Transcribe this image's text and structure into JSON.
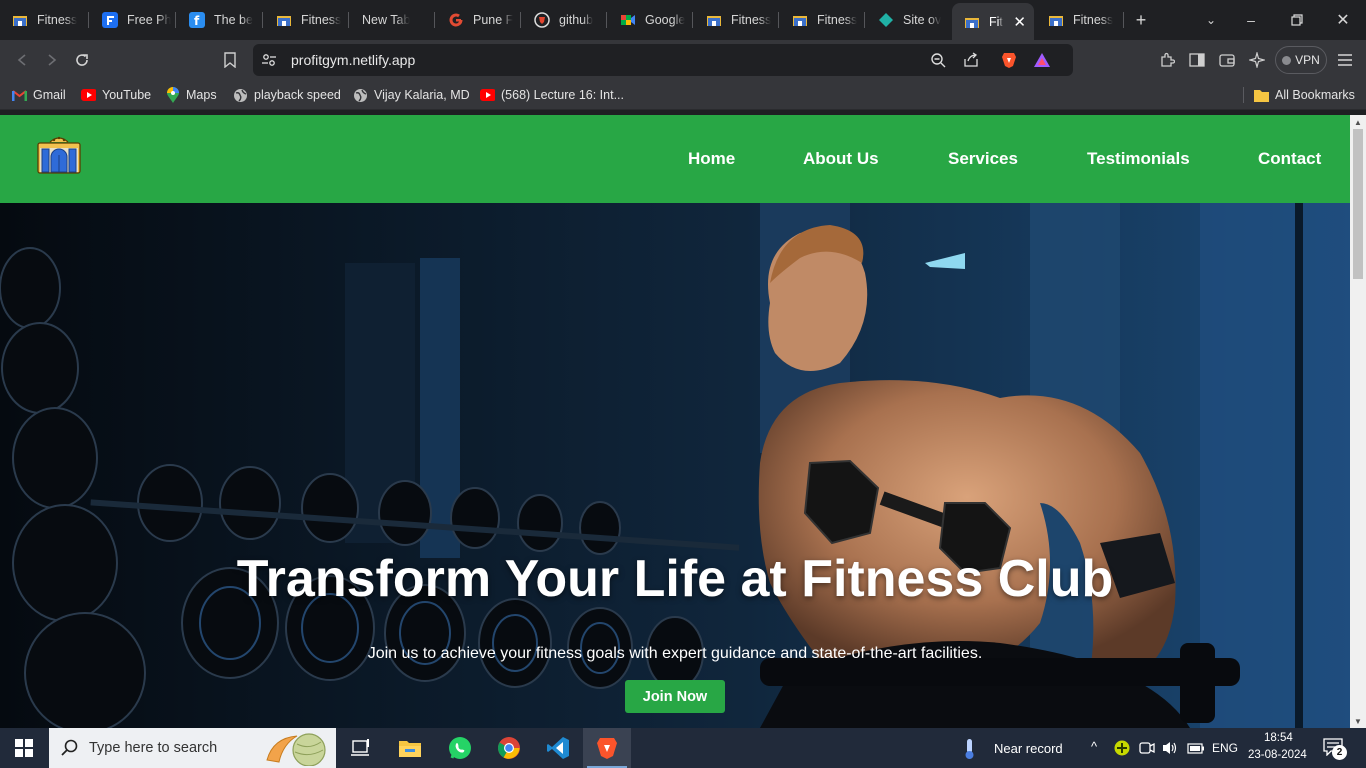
{
  "browser": {
    "tabs": [
      {
        "title": "Fitness",
        "icon": "gym-building-icon"
      },
      {
        "title": "Free Ph",
        "icon": "freepik-icon"
      },
      {
        "title": "The be",
        "icon": "f-app-icon"
      },
      {
        "title": "Fitness",
        "icon": "gym-building-icon"
      },
      {
        "title": "New Tab",
        "icon": ""
      },
      {
        "title": "Pune F",
        "icon": "g-logo-icon"
      },
      {
        "title": "github",
        "icon": "brave-shield-icon"
      },
      {
        "title": "Google",
        "icon": "google-meet-icon"
      },
      {
        "title": "Fitness",
        "icon": "gym-building-icon"
      },
      {
        "title": "Fitness",
        "icon": "gym-building-icon"
      },
      {
        "title": "Site ov",
        "icon": "netlify-icon"
      },
      {
        "title": "Fit",
        "icon": "gym-building-icon",
        "active": true
      },
      {
        "title": "Fitness",
        "icon": "gym-building-icon"
      }
    ],
    "new_tab": "+",
    "url": "profitgym.netlify.app",
    "vpn_label": "VPN",
    "bookmarks": [
      {
        "label": "Gmail",
        "icon": "gmail-icon"
      },
      {
        "label": "YouTube",
        "icon": "youtube-icon"
      },
      {
        "label": "Maps",
        "icon": "maps-pin-icon"
      },
      {
        "label": "playback speed",
        "icon": "globe-icon"
      },
      {
        "label": "Vijay Kalaria, MD",
        "icon": "globe-icon"
      },
      {
        "label": "(568) Lecture 16: Int...",
        "icon": "youtube-icon"
      }
    ],
    "all_bookmarks": "All Bookmarks"
  },
  "site": {
    "nav": [
      "Home",
      "About Us",
      "Services",
      "Testimonials",
      "Contact"
    ],
    "hero_title": "Transform Your Life at Fitness Club",
    "hero_subtitle": "Join us to achieve your fitness goals with expert guidance and state-of-the-art facilities.",
    "cta_label": "Join Now"
  },
  "taskbar": {
    "search_placeholder": "Type here to search",
    "weather": "Near record",
    "language": "ENG",
    "time": "18:54",
    "date": "23-08-2024",
    "notification_count": "2"
  },
  "colors": {
    "brand_green": "#28a745",
    "chrome_dark": "#1f2023",
    "toolbar": "#35363a",
    "taskbar": "#212a3a"
  }
}
